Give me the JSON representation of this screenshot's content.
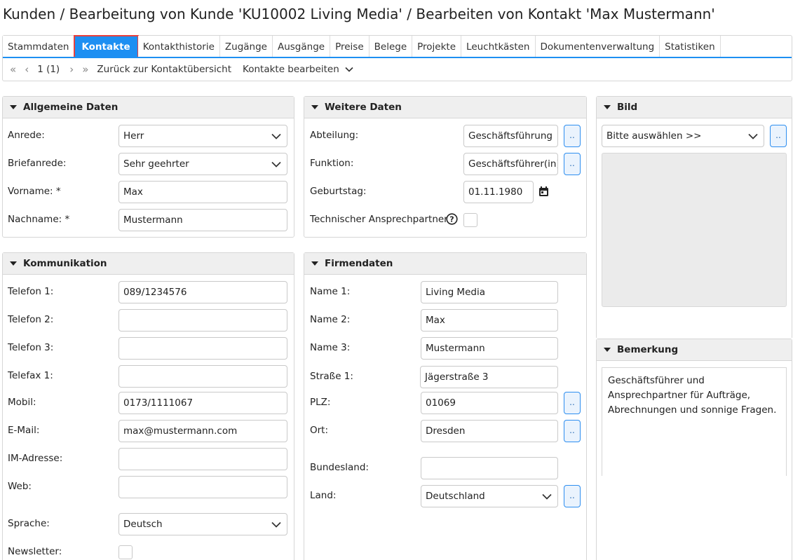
{
  "title": "Kunden / Bearbeitung von Kunde 'KU10002 Living Media' / Bearbeiten von Kontakt 'Max Mustermann'",
  "tabs": [
    "Stammdaten",
    "Kontakte",
    "Kontakthistorie",
    "Zugänge",
    "Ausgänge",
    "Preise",
    "Belege",
    "Projekte",
    "Leuchtkästen",
    "Dokumentenverwaltung",
    "Statistiken"
  ],
  "toolbar": {
    "first": "«",
    "prev": "‹",
    "page": "1 (1)",
    "next": "›",
    "last": "»",
    "back": "Zurück zur Kontaktübersicht",
    "edit": "Kontakte bearbeiten"
  },
  "allgemein": {
    "title": "Allgemeine Daten",
    "anrede_label": "Anrede:",
    "anrede": "Herr",
    "briefanrede_label": "Briefanrede:",
    "briefanrede": "Sehr geehrter",
    "vorname_label": "Vorname:",
    "vorname": "Max",
    "nachname_label": "Nachname:",
    "nachname": "Mustermann",
    "required": "*"
  },
  "weitere": {
    "title": "Weitere Daten",
    "abteilung_label": "Abteilung:",
    "abteilung": "Geschäftsführung",
    "funktion_label": "Funktion:",
    "funktion": "Geschäftsführer(in)",
    "geburtstag_label": "Geburtstag:",
    "geburtstag": "01.11.1980",
    "technisch_label": "Technischer Ansprechpartner:",
    "help": "?"
  },
  "bild": {
    "title": "Bild",
    "select": "Bitte auswählen >>"
  },
  "kommunikation": {
    "title": "Kommunikation",
    "telefon1_label": "Telefon 1:",
    "telefon1": "089/1234576",
    "telefon2_label": "Telefon 2:",
    "telefon2": "",
    "telefon3_label": "Telefon 3:",
    "telefon3": "",
    "telefax1_label": "Telefax 1:",
    "telefax1": "",
    "mobil_label": "Mobil:",
    "mobil": "0173/1111067",
    "email_label": "E-Mail:",
    "email": "max@mustermann.com",
    "im_label": "IM-Adresse:",
    "im": "",
    "web_label": "Web:",
    "web": "",
    "sprache_label": "Sprache:",
    "sprache": "Deutsch",
    "newsletter_label": "Newsletter:"
  },
  "firmendaten": {
    "title": "Firmendaten",
    "name1_label": "Name 1:",
    "name1": "Living Media",
    "name2_label": "Name 2:",
    "name2": "Max",
    "name3_label": "Name 3:",
    "name3": "Mustermann",
    "strasse1_label": "Straße 1:",
    "strasse1": "Jägerstraße 3",
    "plz_label": "PLZ:",
    "plz": "01069",
    "ort_label": "Ort:",
    "ort": "Dresden",
    "bundesland_label": "Bundesland:",
    "bundesland": "",
    "land_label": "Land:",
    "land": "Deutschland"
  },
  "bemerkung": {
    "title": "Bemerkung",
    "text": "Geschäftsführer und Ansprechpartner für Aufträge, Abrechnungen und sonnige Fragen."
  },
  "button_dots": ".."
}
